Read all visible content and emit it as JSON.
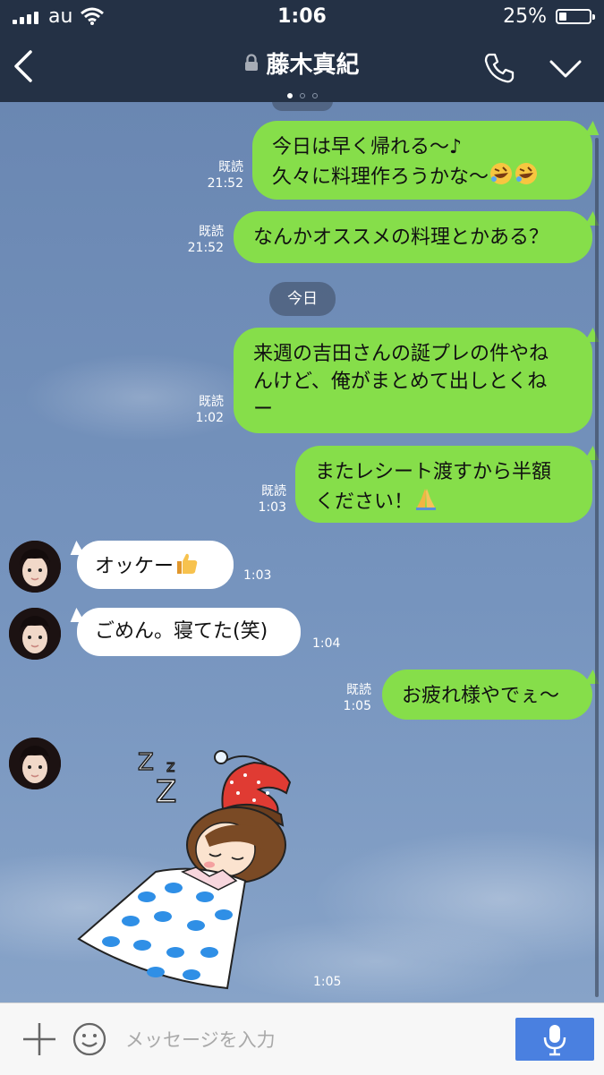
{
  "status_bar": {
    "carrier": "au",
    "time": "1:06",
    "battery": "25%",
    "battery_level": 0.25
  },
  "header": {
    "title": "藤木真紀",
    "page_count": 3,
    "active_page": 1
  },
  "date_separator": "今日",
  "messages": [
    {
      "dir": "out",
      "lines": [
        "今日は早く帰れる〜♪",
        "久々に料理作ろうかな〜"
      ],
      "emoji": [
        "rofl-icon",
        "rofl-icon"
      ],
      "read": "既読",
      "time": "21:52"
    },
    {
      "dir": "out",
      "lines": [
        "なんかオススメの料理とかある？"
      ],
      "read": "既読",
      "time": "21:52"
    },
    {
      "dir": "out",
      "lines": [
        "来週の吉田さんの誕プレの件やね",
        "んけど、俺がまとめて出しとくね",
        "ー"
      ],
      "read": "既読",
      "time": "1:02"
    },
    {
      "dir": "out",
      "lines": [
        "またレシート渡すから半額",
        "ください！"
      ],
      "emoji": [
        "folded-hands-icon"
      ],
      "read": "既読",
      "time": "1:03"
    },
    {
      "dir": "in",
      "lines": [
        "オッケー"
      ],
      "emoji": [
        "thumbs-up-icon"
      ],
      "time": "1:03"
    },
    {
      "dir": "in",
      "lines": [
        "ごめん。寝てた(笑)"
      ],
      "time": "1:04"
    },
    {
      "dir": "out",
      "lines": [
        "お疲れ様やでぇ〜"
      ],
      "read": "既読",
      "time": "1:05"
    },
    {
      "dir": "in",
      "sticker": "sleeping-girl-sticker",
      "time": "1:05"
    }
  ],
  "input": {
    "placeholder": "メッセージを入力"
  },
  "colors": {
    "header_bg": "#243145",
    "out_bubble": "#86de4a",
    "in_bubble": "#ffffff",
    "send_button": "#4a80e0",
    "chat_bg": "#6f8db7"
  }
}
